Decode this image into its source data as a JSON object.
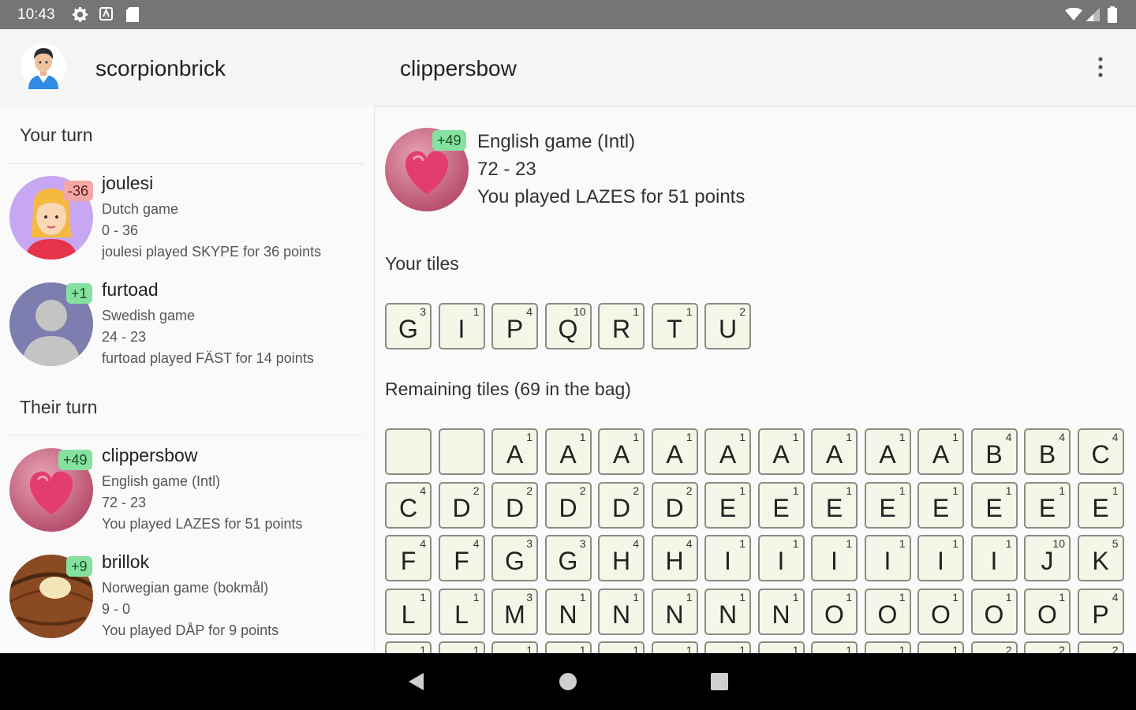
{
  "status_bar": {
    "time": "10:43"
  },
  "app_bar": {
    "username": "scorpionbrick",
    "opponent": "clippersbow"
  },
  "sidebar": {
    "your_turn_label": "Your turn",
    "their_turn_label": "Their turn",
    "your_turn_games": [
      {
        "name": "joulesi",
        "badge": "-36",
        "badge_color": "#f4a7a7",
        "language": "Dutch game",
        "score": "0 - 36",
        "last_move": "joulesi played SKYPE for 36 points"
      },
      {
        "name": "furtoad",
        "badge": "+1",
        "badge_color": "#86e0a0",
        "language": "Swedish game",
        "score": "24 - 23",
        "last_move": "furtoad played FÄST for 14 points"
      }
    ],
    "their_turn_games": [
      {
        "name": "clippersbow",
        "badge": "+49",
        "badge_color": "#86e0a0",
        "language": "English game (Intl)",
        "score": "72 - 23",
        "last_move": "You played LAZES for 51 points"
      },
      {
        "name": "brillok",
        "badge": "+9",
        "badge_color": "#86e0a0",
        "language": "Norwegian game (bokmål)",
        "score": "9 - 0",
        "last_move": "You played DÅP for 9 points"
      }
    ]
  },
  "game": {
    "badge": "+49",
    "language": "English game (Intl)",
    "score": "72 - 23",
    "last_move": "You played LAZES for 51 points",
    "your_tiles_label": "Your tiles",
    "your_tiles": [
      {
        "letter": "G",
        "points": "3"
      },
      {
        "letter": "I",
        "points": "1"
      },
      {
        "letter": "P",
        "points": "4"
      },
      {
        "letter": "Q",
        "points": "10"
      },
      {
        "letter": "R",
        "points": "1"
      },
      {
        "letter": "T",
        "points": "1"
      },
      {
        "letter": "U",
        "points": "2"
      }
    ],
    "remaining_label": "Remaining tiles (69 in the bag)",
    "remaining_rows": [
      [
        {
          "letter": "",
          "points": ""
        },
        {
          "letter": "",
          "points": ""
        },
        {
          "letter": "A",
          "points": "1"
        },
        {
          "letter": "A",
          "points": "1"
        },
        {
          "letter": "A",
          "points": "1"
        },
        {
          "letter": "A",
          "points": "1"
        },
        {
          "letter": "A",
          "points": "1"
        },
        {
          "letter": "A",
          "points": "1"
        },
        {
          "letter": "A",
          "points": "1"
        },
        {
          "letter": "A",
          "points": "1"
        },
        {
          "letter": "A",
          "points": "1"
        },
        {
          "letter": "B",
          "points": "4"
        },
        {
          "letter": "B",
          "points": "4"
        },
        {
          "letter": "C",
          "points": "4"
        }
      ],
      [
        {
          "letter": "C",
          "points": "4"
        },
        {
          "letter": "D",
          "points": "2"
        },
        {
          "letter": "D",
          "points": "2"
        },
        {
          "letter": "D",
          "points": "2"
        },
        {
          "letter": "D",
          "points": "2"
        },
        {
          "letter": "D",
          "points": "2"
        },
        {
          "letter": "E",
          "points": "1"
        },
        {
          "letter": "E",
          "points": "1"
        },
        {
          "letter": "E",
          "points": "1"
        },
        {
          "letter": "E",
          "points": "1"
        },
        {
          "letter": "E",
          "points": "1"
        },
        {
          "letter": "E",
          "points": "1"
        },
        {
          "letter": "E",
          "points": "1"
        },
        {
          "letter": "E",
          "points": "1"
        }
      ],
      [
        {
          "letter": "F",
          "points": "4"
        },
        {
          "letter": "F",
          "points": "4"
        },
        {
          "letter": "G",
          "points": "3"
        },
        {
          "letter": "G",
          "points": "3"
        },
        {
          "letter": "H",
          "points": "4"
        },
        {
          "letter": "H",
          "points": "4"
        },
        {
          "letter": "I",
          "points": "1"
        },
        {
          "letter": "I",
          "points": "1"
        },
        {
          "letter": "I",
          "points": "1"
        },
        {
          "letter": "I",
          "points": "1"
        },
        {
          "letter": "I",
          "points": "1"
        },
        {
          "letter": "I",
          "points": "1"
        },
        {
          "letter": "J",
          "points": "10"
        },
        {
          "letter": "K",
          "points": "5"
        }
      ],
      [
        {
          "letter": "L",
          "points": "1"
        },
        {
          "letter": "L",
          "points": "1"
        },
        {
          "letter": "M",
          "points": "3"
        },
        {
          "letter": "N",
          "points": "1"
        },
        {
          "letter": "N",
          "points": "1"
        },
        {
          "letter": "N",
          "points": "1"
        },
        {
          "letter": "N",
          "points": "1"
        },
        {
          "letter": "N",
          "points": "1"
        },
        {
          "letter": "O",
          "points": "1"
        },
        {
          "letter": "O",
          "points": "1"
        },
        {
          "letter": "O",
          "points": "1"
        },
        {
          "letter": "O",
          "points": "1"
        },
        {
          "letter": "O",
          "points": "1"
        },
        {
          "letter": "P",
          "points": "4"
        }
      ],
      [
        {
          "letter": "",
          "points": "1"
        },
        {
          "letter": "",
          "points": "1"
        },
        {
          "letter": "",
          "points": "1"
        },
        {
          "letter": "",
          "points": "1"
        },
        {
          "letter": "",
          "points": "1"
        },
        {
          "letter": "",
          "points": "1"
        },
        {
          "letter": "",
          "points": "1"
        },
        {
          "letter": "",
          "points": "1"
        },
        {
          "letter": "",
          "points": "1"
        },
        {
          "letter": "",
          "points": "1"
        },
        {
          "letter": "",
          "points": "1"
        },
        {
          "letter": "",
          "points": "2"
        },
        {
          "letter": "",
          "points": "2"
        },
        {
          "letter": "",
          "points": "2"
        }
      ]
    ]
  },
  "colors": {
    "status_bar": "#757575",
    "tile_face": "#f5f5e8",
    "positive_badge": "#86e0a0",
    "negative_badge": "#f4a7a7"
  },
  "icons": [
    "settings-icon",
    "notification-icon",
    "sd-card-icon",
    "wifi-icon",
    "signal-icon",
    "battery-icon",
    "overflow-menu-icon",
    "back-icon",
    "home-icon",
    "recents-icon"
  ]
}
